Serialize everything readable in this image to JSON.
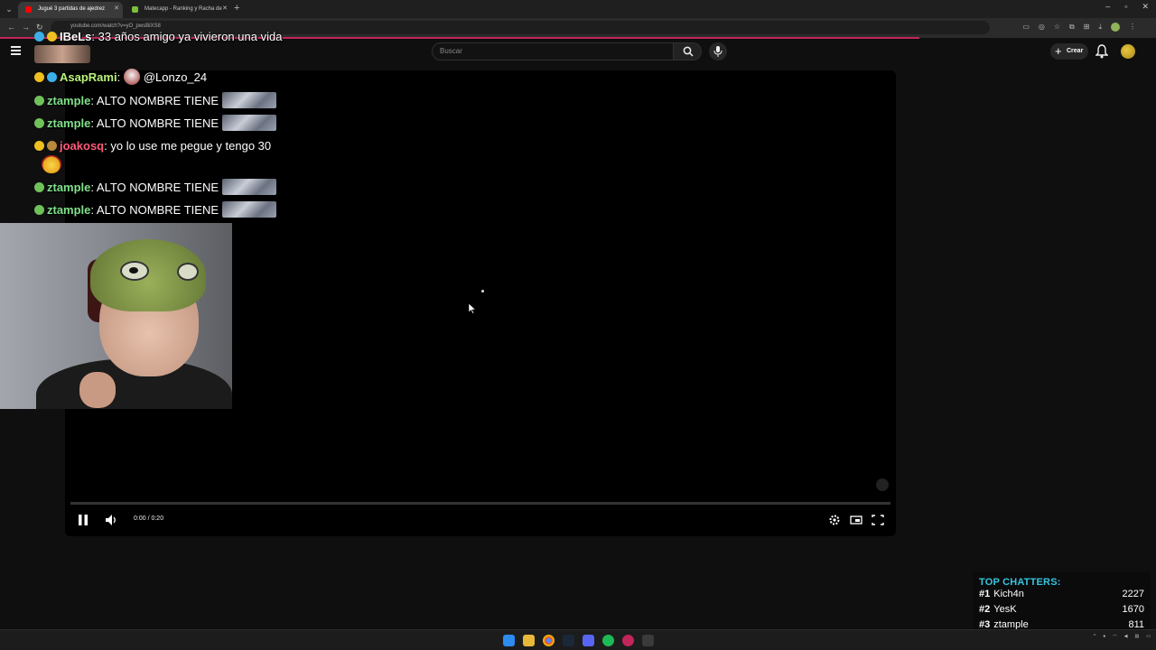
{
  "browser": {
    "tabs": [
      {
        "title": "Jugué 3 partidas de ajedrez",
        "active": true
      },
      {
        "title": "Matecapp - Ranking y Racha de",
        "active": false
      }
    ],
    "url": "youtube.com/watch?v=yO_pwsBiXS8"
  },
  "youtube": {
    "search_placeholder": "Buscar",
    "create_label": "Crear"
  },
  "player": {
    "time": "0:00 / 0:20",
    "progress": 0.0,
    "state": "playing"
  },
  "chat": [
    {
      "user": "IBeLs",
      "text": ": 33 años amigo ya vivieron una vida",
      "user_color": "#ffffff"
    },
    {
      "user": "AsapRami",
      "text": "@Lonzo_24",
      "user_color": "#b9f27c"
    },
    {
      "user": "ztample",
      "text": ": ALTO NOMBRE TIENE",
      "user_color": "#7fe08a"
    },
    {
      "user": "ztample",
      "text": ": ALTO NOMBRE TIENE",
      "user_color": "#7fe08a"
    },
    {
      "user": "joakosq",
      "text": ": yo lo use me pegue y tengo 30",
      "user_color": "#ff5a78"
    },
    {
      "user": "ztample",
      "text": ": ALTO NOMBRE TIENE",
      "user_color": "#7fe08a"
    },
    {
      "user": "ztample",
      "text": ": ALTO NOMBRE TIENE",
      "user_color": "#7fe08a"
    }
  ],
  "top_chatters": {
    "title": "TOP CHATTERS:",
    "rows": [
      {
        "rank": "#1",
        "name": "Kich4n",
        "count": "2227"
      },
      {
        "rank": "#2",
        "name": "YesK",
        "count": "1670"
      },
      {
        "rank": "#3",
        "name": "ztample",
        "count": "811"
      }
    ]
  },
  "colors": {
    "accent_pink": "#c0265a",
    "chatters_title": "#35c6e0",
    "player_bg": "#000000"
  }
}
